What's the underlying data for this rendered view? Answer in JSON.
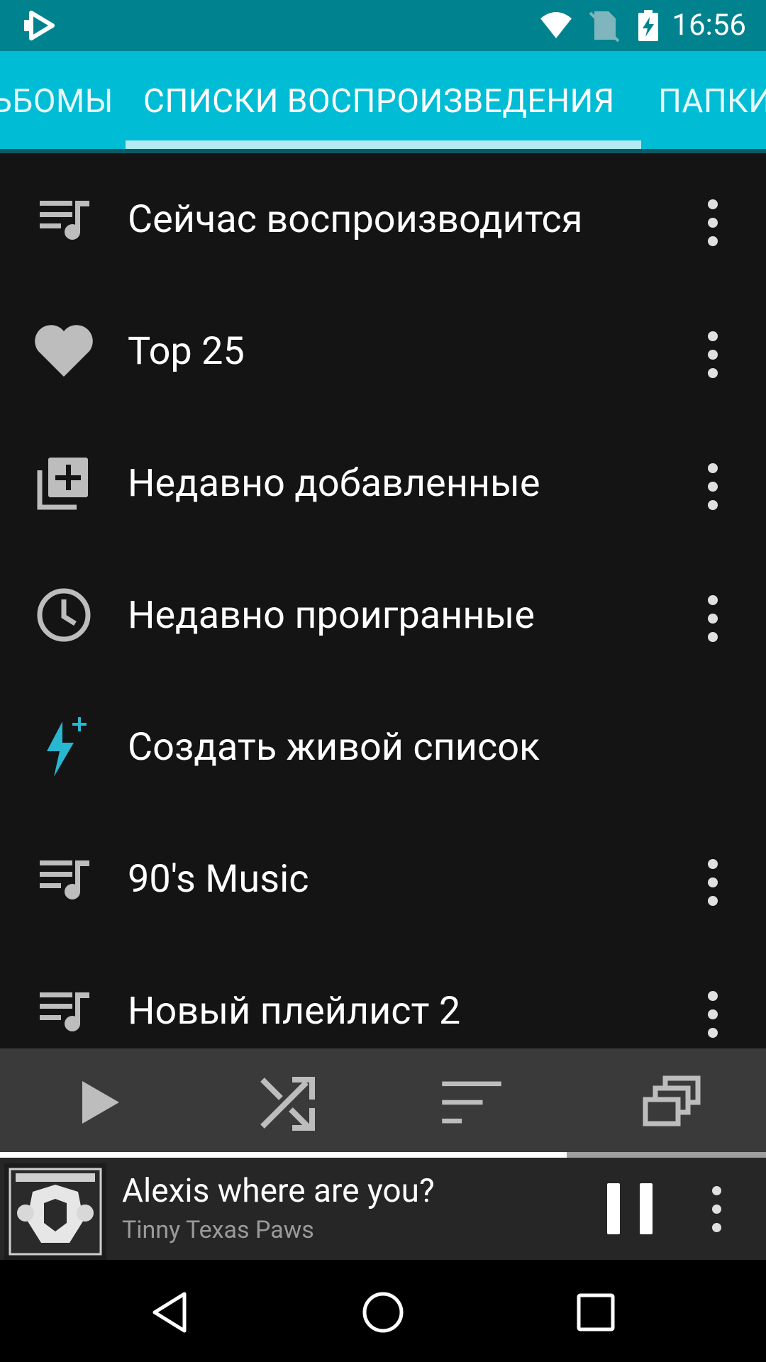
{
  "status_bar": {
    "time": "16:56",
    "icons": [
      "app-icon",
      "wifi-icon",
      "no-sim-icon",
      "battery-charging-icon"
    ]
  },
  "tabs": [
    {
      "label": "ЬБОМЫ",
      "selected": false
    },
    {
      "label": "СПИСКИ ВОСПРОИЗВЕДЕНИЯ",
      "selected": true
    },
    {
      "label": "ПАПКИ",
      "selected": false
    }
  ],
  "playlists": [
    {
      "label": "Сейчас воспроизводится",
      "icon": "queue-music-icon"
    },
    {
      "label": "Top 25",
      "icon": "heart-icon"
    },
    {
      "label": "Недавно добавленные",
      "icon": "library-add-icon"
    },
    {
      "label": "Недавно проигранные",
      "icon": "clock-icon"
    },
    {
      "label": "Создать живой список",
      "icon": "lightning-plus-icon"
    },
    {
      "label": "90's Music",
      "icon": "queue-music-icon"
    },
    {
      "label": "Новый плейлист 2",
      "icon": "queue-music-icon"
    }
  ],
  "action_bar": [
    "play-icon",
    "shuffle-icon",
    "sort-icon",
    "view-mode-icon"
  ],
  "now_playing": {
    "title": "Alexis where are you?",
    "artist": "Tinny Texas Paws",
    "progress": 0.74
  },
  "colors": {
    "status_bar": "#00838f",
    "tab_bar": "#00bcd4",
    "tab_indicator": "#b2ebf2",
    "background": "#141414",
    "accent_icon": "#29b6d0"
  },
  "nav_bar": [
    "back-icon",
    "home-icon",
    "recents-icon"
  ]
}
